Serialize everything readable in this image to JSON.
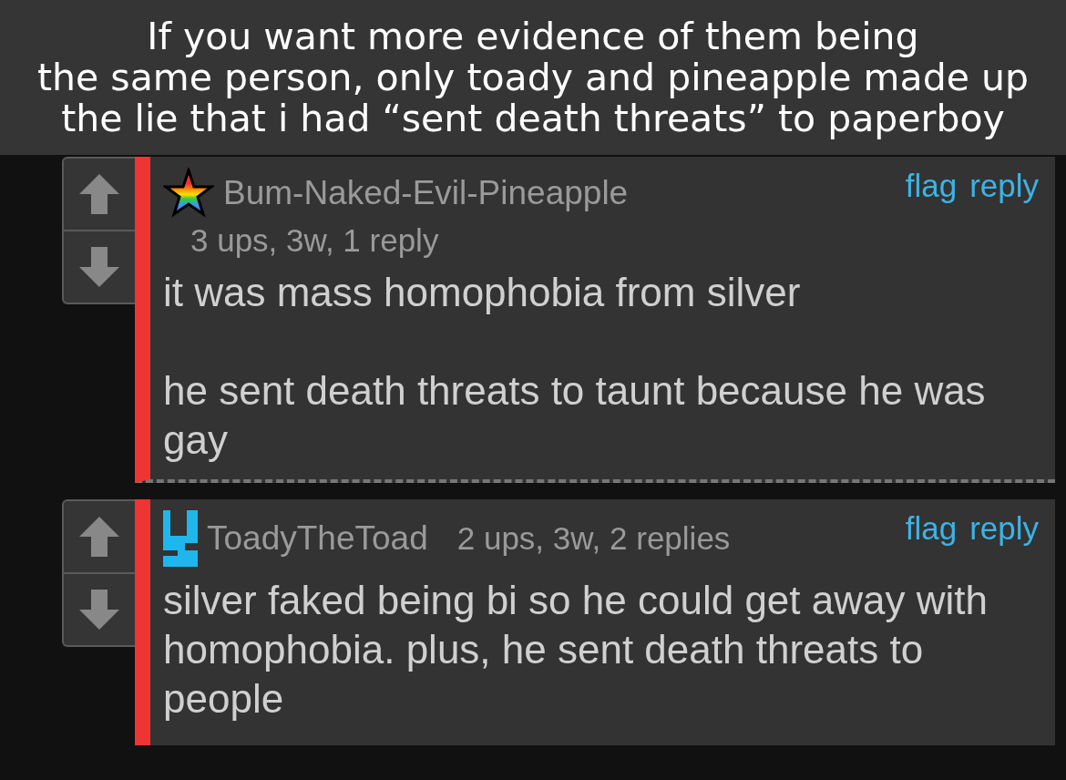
{
  "caption": [
    "If you want more evidence of them being",
    "the same person, only toady and pineapple made up",
    "the lie that i had “sent death threats” to paperboy"
  ],
  "comments": [
    {
      "kind": "star",
      "username": "Bum-Naked-Evil-Pineapple",
      "meta": "3 ups, 3w, 1 reply",
      "meta_inline": false,
      "actions": [
        "flag",
        "reply"
      ],
      "paragraphs": [
        "it was mass homophobia from silver",
        "he sent death threats to taunt because he was gay"
      ]
    },
    {
      "kind": "block",
      "username": "ToadyTheToad",
      "meta": "2 ups, 3w, 2 replies",
      "meta_inline": true,
      "actions": [
        "flag",
        "reply"
      ],
      "paragraphs": [
        "silver faked being bi so he could get away with homophobia. plus, he sent death threats to people"
      ]
    }
  ]
}
